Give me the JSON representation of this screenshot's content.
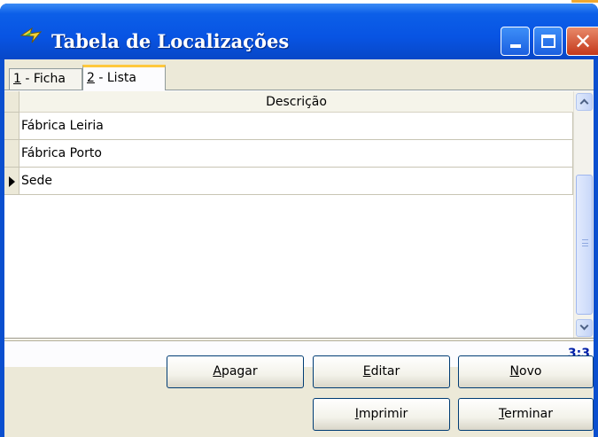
{
  "window": {
    "title": "Tabela de Localizações"
  },
  "tabs": [
    {
      "mnemonic": "1",
      "rest": " - Ficha"
    },
    {
      "mnemonic": "2",
      "rest": " - Lista"
    }
  ],
  "grid": {
    "column_header": "Descrição",
    "rows": [
      "Fábrica Leiria",
      "Fábrica Porto",
      "Sede"
    ],
    "current_row_index": 2
  },
  "status": {
    "record_counter": "3:3"
  },
  "buttons": {
    "apagar": {
      "mnemonic": "A",
      "rest": "pagar"
    },
    "editar": {
      "mnemonic": "E",
      "rest": "ditar"
    },
    "novo": {
      "mnemonic": "N",
      "rest": "ovo"
    },
    "imprimir": {
      "mnemonic": "I",
      "rest": "mprimir"
    },
    "terminar": {
      "mnemonic": "T",
      "rest": "erminar"
    }
  },
  "colors": {
    "titlebar": "#0854e3",
    "client": "#ece9d8",
    "tab_highlight": "#ffc83c",
    "counter": "#001fa8"
  },
  "icons": {
    "app": "location-icon",
    "minimize": "minimize-icon",
    "maximize": "maximize-icon",
    "close": "close-icon",
    "row_pointer": "row-pointer-icon",
    "scroll_up": "chevron-up-icon",
    "scroll_down": "chevron-down-icon"
  }
}
